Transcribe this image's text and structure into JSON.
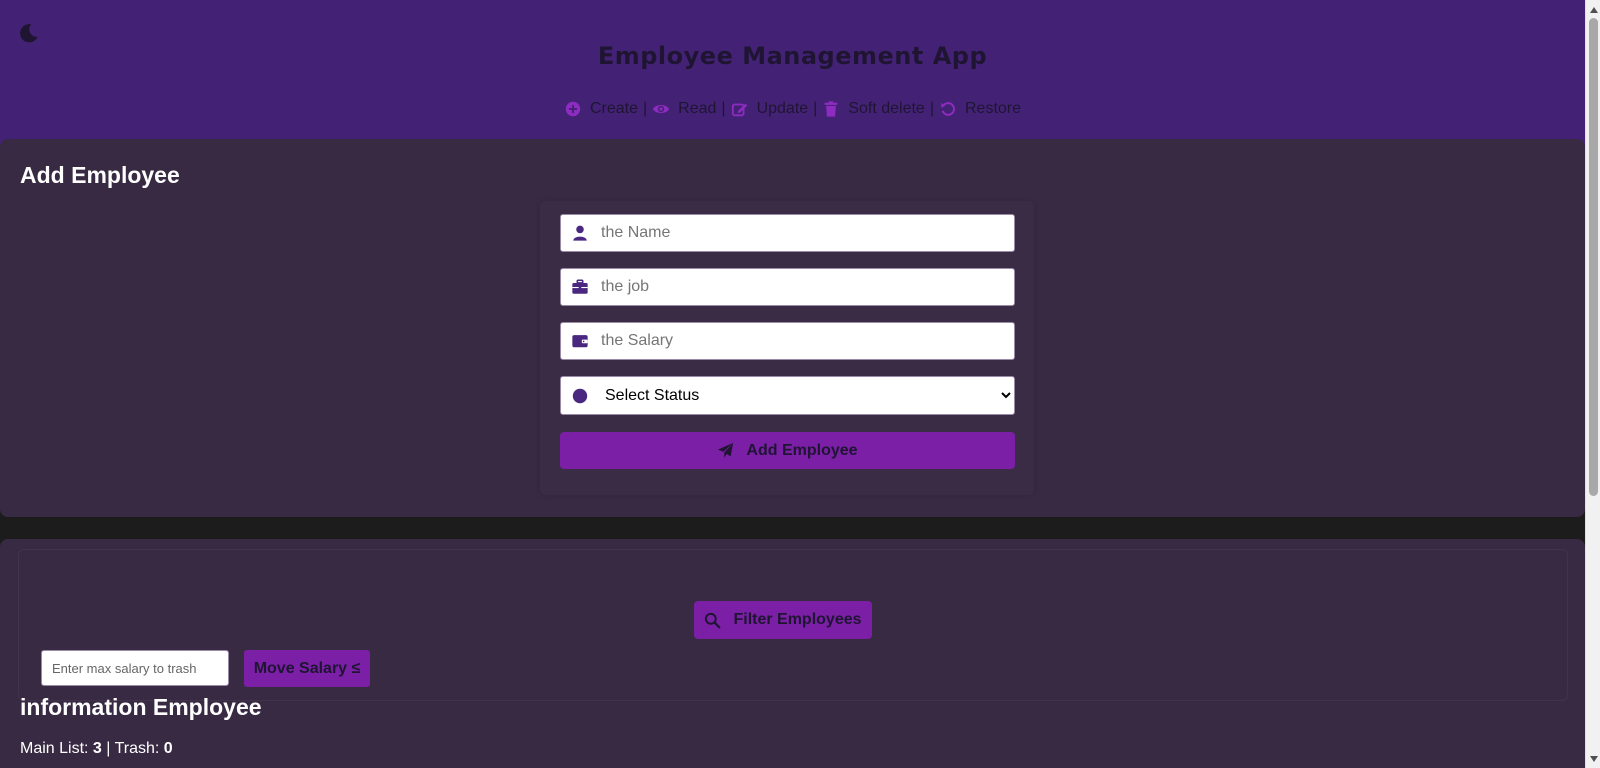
{
  "header": {
    "title": "Employee Management App",
    "theme_icon": "moon-icon",
    "nav": [
      {
        "label": "Create",
        "icon": "plus-circle-icon"
      },
      {
        "label": "Read",
        "icon": "eye-icon"
      },
      {
        "label": "Update",
        "icon": "edit-icon"
      },
      {
        "label": "Soft delete",
        "icon": "trash-icon"
      },
      {
        "label": "Restore",
        "icon": "restore-icon"
      }
    ],
    "separator": "|"
  },
  "add_form": {
    "title": "Add Employee",
    "name_placeholder": "the Name",
    "job_placeholder": "the job",
    "salary_placeholder": "the Salary",
    "status_selected": "Select Status",
    "submit_label": "Add Employee"
  },
  "info": {
    "filter_label": "Filter Employees",
    "trash_placeholder": "Enter max salary to trash",
    "move_label": "Move Salary ≤",
    "title": "information Employee",
    "main_list_label": "Main List:",
    "main_list_count": "3",
    "trash_label": "Trash:",
    "trash_count": "0"
  },
  "colors": {
    "header_bg": "#432275",
    "card_bg": "#382a42",
    "accent": "#7a1fa6",
    "page_bg": "#1c1c1c"
  }
}
